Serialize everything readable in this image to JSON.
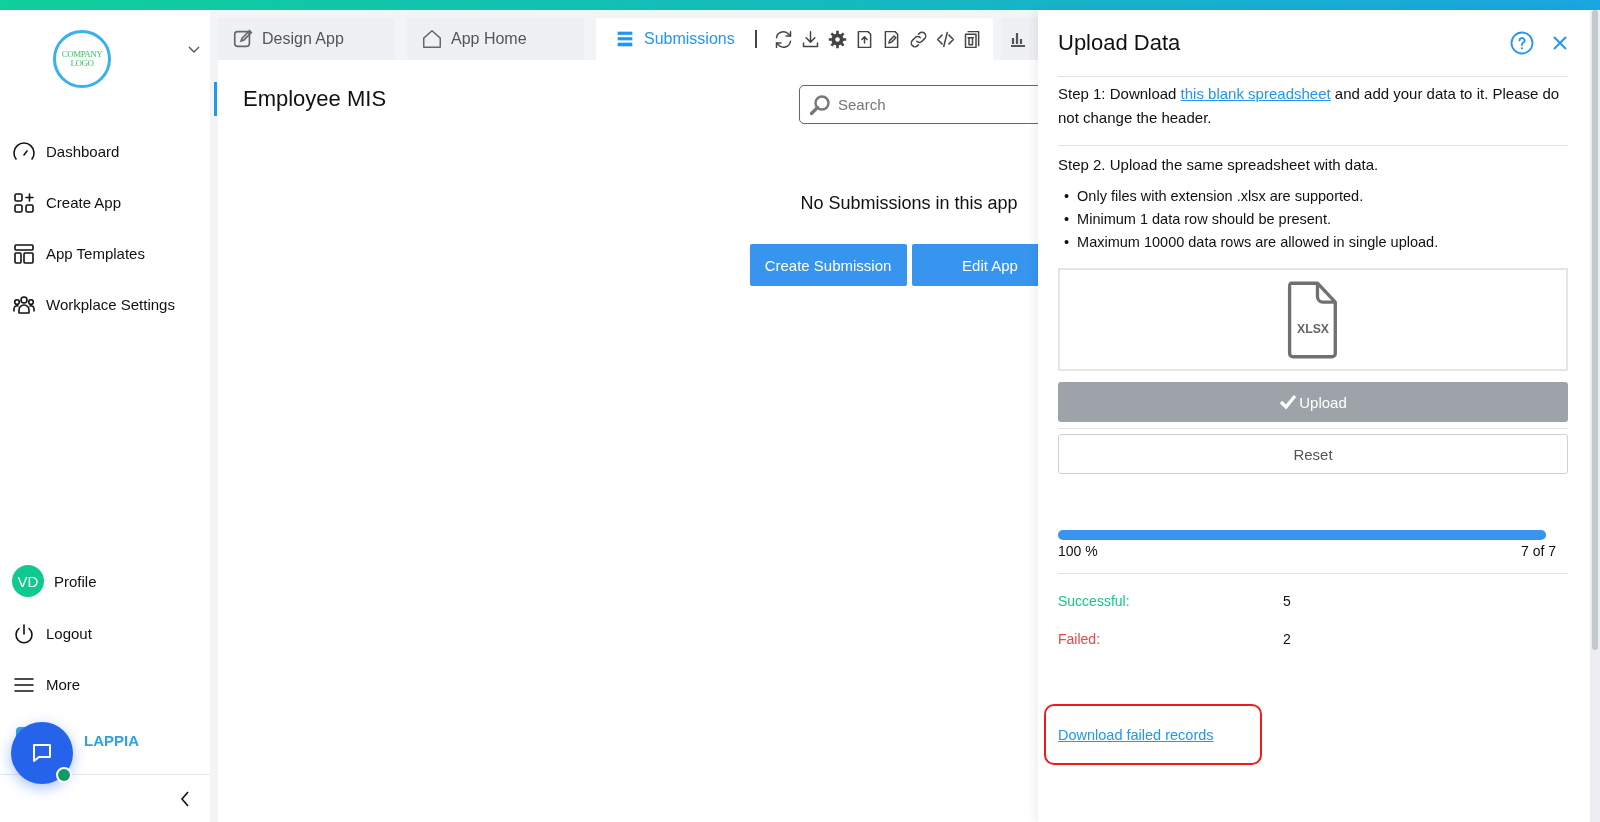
{
  "sidebar": {
    "logo_lines": [
      "COMPANY",
      "LOGO"
    ],
    "nav_items": [
      {
        "label": "Dashboard"
      },
      {
        "label": "Create App"
      },
      {
        "label": "App Templates"
      },
      {
        "label": "Workplace Settings"
      }
    ],
    "profile": {
      "initials": "VD",
      "label": "Profile"
    },
    "bottom_items": [
      {
        "label": "Logout"
      },
      {
        "label": "More"
      }
    ],
    "brand": "LAPPIA"
  },
  "tabs": [
    {
      "label": "Design App",
      "selected": false
    },
    {
      "label": "App Home",
      "selected": false
    },
    {
      "label": "Submissions",
      "selected": true
    }
  ],
  "page": {
    "title": "Employee MIS",
    "search": {
      "placeholder": "Search"
    },
    "empty_message": "No Submissions in this app",
    "buttons": [
      "Create Submission",
      "Edit App"
    ]
  },
  "panel": {
    "title": "Upload Data",
    "step1": {
      "before": "Step 1: Download ",
      "link": "this blank spreadsheet",
      "after": " and add your data to it. Please do not change the header."
    },
    "step2": "Step 2. Upload the same spreadsheet with data.",
    "rules": [
      {
        "marker": "•",
        "text": "Only files with extension .xlsx are supported."
      },
      {
        "marker": "•",
        "text": "Minimum 1 data row should be present."
      },
      {
        "marker": "•",
        "text": "Maximum 10000 data rows are allowed in single upload."
      }
    ],
    "file_label": "XLSX",
    "upload_button": {
      "label": "Upload",
      "disabled": true
    },
    "reset_button": "Reset",
    "progress": {
      "level": 1,
      "percent": "100 %",
      "count": "7 of 7"
    },
    "results": [
      {
        "label": "Successful:",
        "value": "5",
        "color": "#12c98b"
      },
      {
        "label": "Failed:",
        "value": "2",
        "color": "#ef4444"
      }
    ],
    "failed_link": "Download failed records"
  }
}
